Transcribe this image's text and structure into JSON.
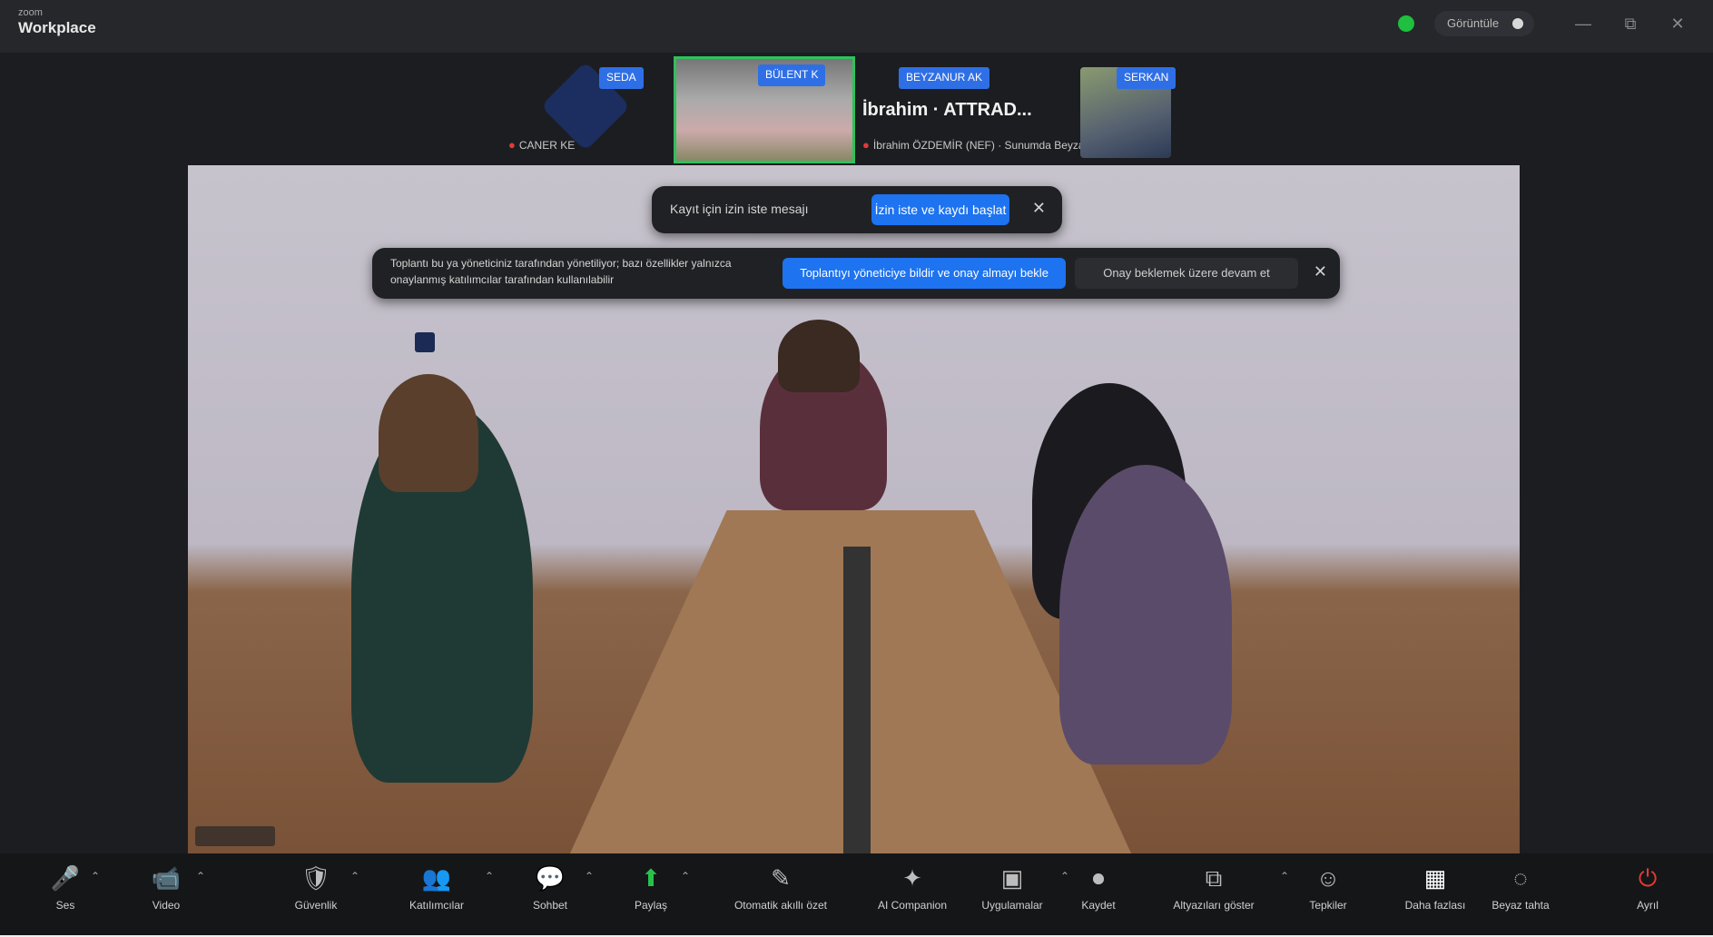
{
  "titlebar": {
    "app_small": "zoom",
    "app_name": "Workplace",
    "meeting_pill": "Görüntüle",
    "win_minimize": "—",
    "win_maximize": "⧉",
    "win_close": "✕"
  },
  "thumbnails": [
    {
      "tag": "SEDA",
      "sub": "CANER KE"
    },
    {
      "tag": "BÜLENT K"
    },
    {
      "tag": "BEYZANUR AK",
      "title": "İbrahim · ATTRAD...",
      "sub": "İbrahim ÖZDEMİR (NEF) · Sunumda Beyza"
    },
    {
      "tag": "SERKAN"
    }
  ],
  "banner_1": {
    "text": "Kayıt için izin iste mesajı",
    "button": "İzin iste ve kaydı başlat",
    "close": "✕"
  },
  "banner_2": {
    "text": "Toplantı bu ya yöneticiniz tarafından yönetiliyor; bazı özellikler yalnızca onaylanmış katılımcılar tarafından kullanılabilir",
    "button_primary": "Toplantıyı yöneticiye bildir ve onay almayı bekle",
    "button_secondary": "Onay beklemek üzere devam et",
    "close": "✕"
  },
  "toolbar": [
    {
      "id": "mic",
      "icon": "mic-off-icon",
      "glyph": "🎤",
      "label": "Ses",
      "caret": true,
      "color": "red"
    },
    {
      "id": "video",
      "icon": "video-off-icon",
      "glyph": "📹",
      "label": "Video",
      "caret": true,
      "color": "red"
    },
    {
      "id": "security",
      "icon": "shield-icon",
      "glyph": "🛡",
      "label": "Güvenlik",
      "caret": true,
      "color": ""
    },
    {
      "id": "participants",
      "icon": "participants-icon",
      "glyph": "👥",
      "label": "Katılımcılar",
      "caret": true,
      "color": ""
    },
    {
      "id": "chat",
      "icon": "chat-icon",
      "glyph": "💬",
      "label": "Sohbet",
      "caret": true,
      "color": ""
    },
    {
      "id": "share",
      "icon": "share-screen-icon",
      "glyph": "⬆",
      "label": "Paylaş",
      "caret": true,
      "color": "green"
    },
    {
      "id": "summary",
      "icon": "summary-icon",
      "glyph": "✎",
      "label": "Otomatik akıllı özet",
      "caret": false,
      "color": ""
    },
    {
      "id": "companion",
      "icon": "ai-companion-icon",
      "glyph": "✦",
      "label": "AI Companion",
      "caret": false,
      "color": ""
    },
    {
      "id": "apps",
      "icon": "apps-icon",
      "glyph": "▣",
      "label": "Uygulamalar",
      "caret": true,
      "color": ""
    },
    {
      "id": "record",
      "icon": "record-icon",
      "glyph": "⏺",
      "label": "Kaydet",
      "caret": false,
      "color": ""
    },
    {
      "id": "captions",
      "icon": "captions-icon",
      "glyph": "⧉",
      "label": "Altyazıları göster",
      "caret": true,
      "color": ""
    },
    {
      "id": "reactions",
      "icon": "reactions-icon",
      "glyph": "☺",
      "label": "Tepkiler",
      "caret": false,
      "color": ""
    },
    {
      "id": "more",
      "icon": "grid-icon",
      "glyph": "▦",
      "label": "Daha fazlası",
      "caret": false,
      "color": "white"
    },
    {
      "id": "whiteboard",
      "icon": "whiteboard-icon",
      "glyph": "◌",
      "label": "Beyaz tahta",
      "caret": false,
      "color": ""
    },
    {
      "id": "leave",
      "icon": "leave-icon",
      "glyph": "⏻",
      "label": "Ayrıl",
      "caret": false,
      "color": "red"
    }
  ]
}
